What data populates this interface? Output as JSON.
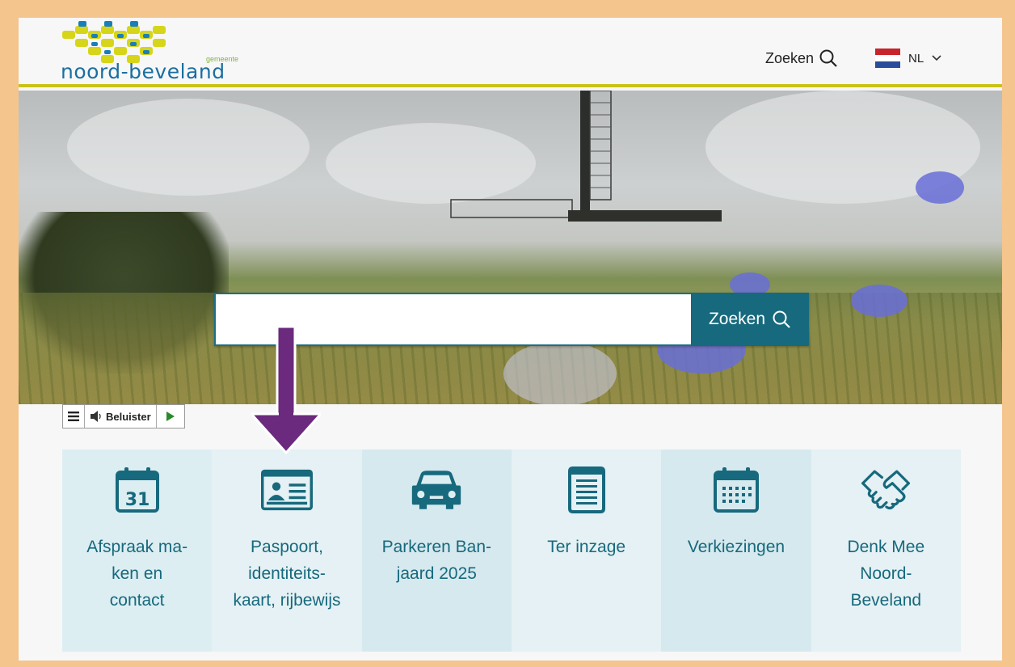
{
  "header": {
    "logo_text": "noord-beveland",
    "logo_sub": "gemeente",
    "search_label": "Zoeken",
    "language": "NL"
  },
  "hero": {
    "search_input_value": "",
    "search_button_label": "Zoeken"
  },
  "readspeaker": {
    "listen_label": "Beluister"
  },
  "tiles": [
    {
      "label": "Afspraak ma-\nken en\ncontact",
      "icon": "calendar-31-icon",
      "bg": "#dceef2"
    },
    {
      "label": "Paspoort, identiteits-\nkaart, rijbewijs",
      "icon": "id-card-icon",
      "bg": "#e5f1f4"
    },
    {
      "label": "Parkeren Ban-\njaard 2025",
      "icon": "car-icon",
      "bg": "#d6e9ee"
    },
    {
      "label": "Ter inzage",
      "icon": "document-icon",
      "bg": "#e5f1f4"
    },
    {
      "label": "Verkiezingen",
      "icon": "calendar-grid-icon",
      "bg": "#d6e9ee"
    },
    {
      "label": "Denk Mee\nNoord-\nBeveland",
      "icon": "handshake-icon",
      "bg": "#e5f1f4"
    }
  ],
  "colors": {
    "accent": "#17697d",
    "header_border": "#c9c21a",
    "frame": "#f5c58e",
    "arrow": "#6b2a7d"
  }
}
